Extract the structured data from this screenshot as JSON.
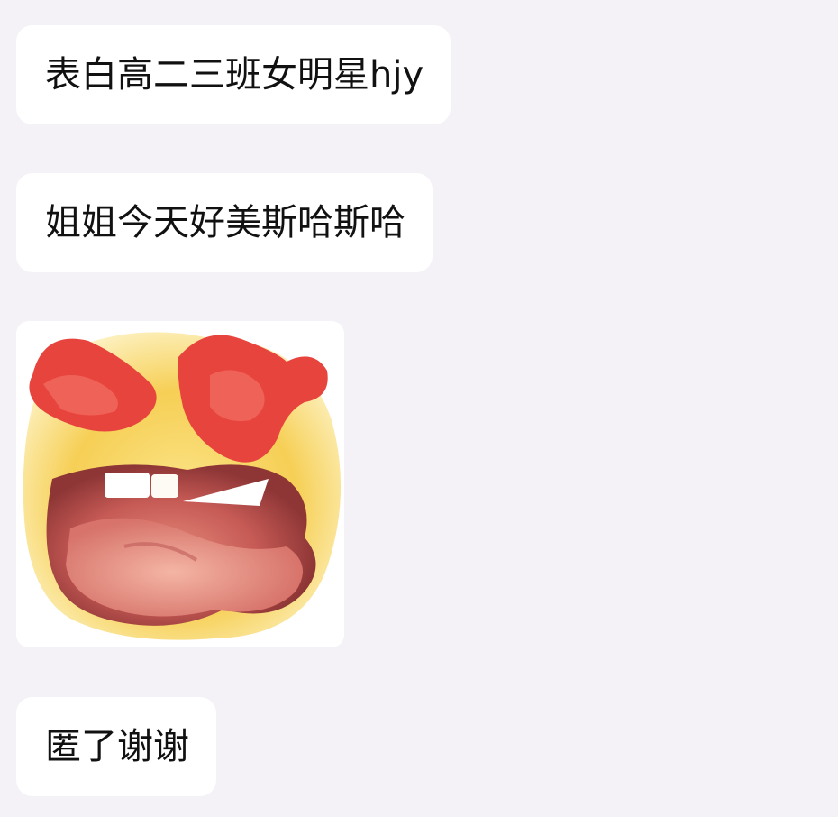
{
  "messages": [
    {
      "type": "text",
      "text": "表白高二三班女明星hjy"
    },
    {
      "type": "text",
      "text": "姐姐今天好美斯哈斯哈"
    },
    {
      "type": "sticker",
      "icon": "heart-eyes-drooling-emoji-icon"
    },
    {
      "type": "text",
      "text": "匿了谢谢"
    }
  ],
  "colors": {
    "background": "#f4f2f6",
    "bubble": "#ffffff",
    "text": "#111111",
    "emoji_yellow": "#f7d35a",
    "emoji_red": "#e8443e",
    "emoji_mouth": "#b24a4a"
  }
}
